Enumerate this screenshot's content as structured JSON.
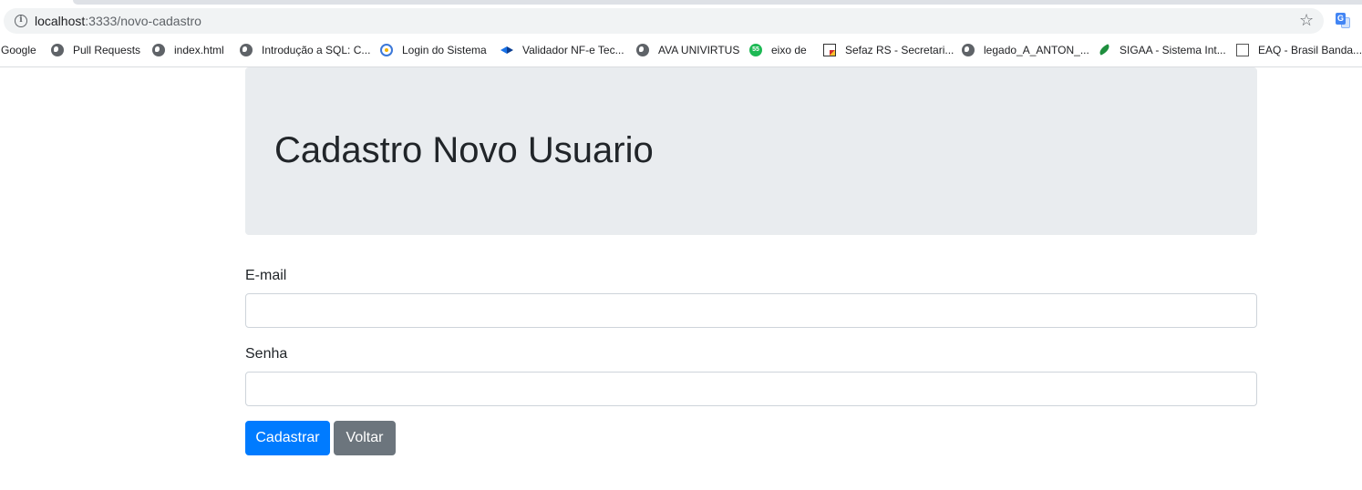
{
  "browser": {
    "url_host": "localhost",
    "url_path": ":3333/novo-cadastro",
    "bookmarks": [
      {
        "label": "Google",
        "icon": "none"
      },
      {
        "label": "Pull Requests",
        "icon": "globe-icon"
      },
      {
        "label": "index.html",
        "icon": "globe-icon"
      },
      {
        "label": "Introdução a SQL: C...",
        "icon": "globe-icon"
      },
      {
        "label": "Login do Sistema",
        "icon": "login-favicon-icon"
      },
      {
        "label": "Validador NF-e Tec...",
        "icon": "nfe-favicon-icon"
      },
      {
        "label": "AVA UNIVIRTUS",
        "icon": "globe-icon"
      },
      {
        "label": "eixo de",
        "icon": "eixo-favicon-icon"
      },
      {
        "label": "Sefaz RS - Secretari...",
        "icon": "sefaz-favicon-icon"
      },
      {
        "label": "legado_A_ANTON_...",
        "icon": "globe-icon"
      },
      {
        "label": "SIGAA - Sistema Int...",
        "icon": "sigaa-favicon-icon"
      },
      {
        "label": "EAQ - Brasil Banda...",
        "icon": "eaq-favicon-icon"
      }
    ]
  },
  "page": {
    "title": "Cadastro Novo Usuario",
    "email_label": "E-mail",
    "email_value": "",
    "senha_label": "Senha",
    "senha_value": "",
    "submit_label": "Cadastrar",
    "back_label": "Voltar"
  },
  "colors": {
    "primary": "#007bff",
    "secondary": "#6c757d",
    "jumbotron": "#e9ecef"
  }
}
